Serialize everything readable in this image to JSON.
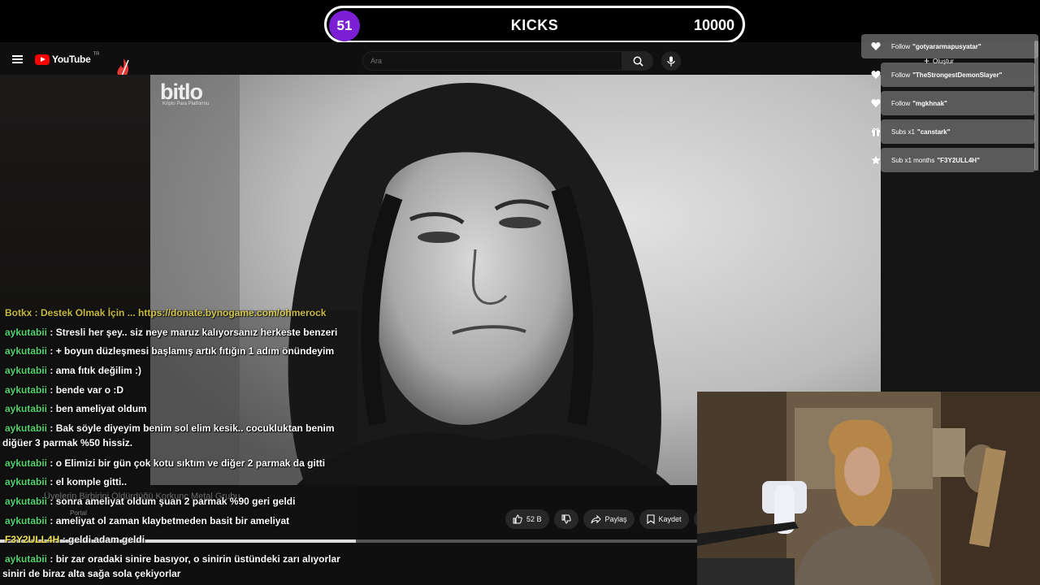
{
  "counter": {
    "current": "51",
    "label": "KICKS",
    "goal": "10000",
    "accent": "#7b1fd4"
  },
  "youtube": {
    "logo_text": "YouTube",
    "country_code": "TR",
    "search_placeholder": "Ara",
    "create_label": "Oluştur"
  },
  "video": {
    "watermark": "bitlo",
    "watermark_sub": "Kripto Para Platformu",
    "title": "Üyelerin Birbirini Öldürdüğü Korkunç Metal Grubu",
    "channel": "Portal",
    "like_count": "52 B",
    "share_label": "Paylaş",
    "save_label": "Kaydet",
    "progress": 0.51
  },
  "alerts": [
    {
      "icon": "heart-icon",
      "prefix": "Follow",
      "name": "\"gotyararmapusyatar\""
    },
    {
      "icon": "heart-icon",
      "prefix": "Follow",
      "name": "\"TheStrongestDemonSlayer\""
    },
    {
      "icon": "heart-icon",
      "prefix": "Follow",
      "name": "\"mgkhnak\""
    },
    {
      "icon": "gift-icon",
      "prefix": "Subs x1",
      "name": "\"canstark\""
    },
    {
      "icon": "star-icon",
      "prefix": "Sub x1 months",
      "name": "\"F3Y2ULL4H\""
    }
  ],
  "chat": {
    "partial_top": "Botkx : Destek Olmak İçin ... https://donate.bynogame.com/ohmerock",
    "lines": [
      {
        "user": "aykutabii",
        "text": " : Stresli her şey.. siz neye maruz kalıyorsanız herkeste benzeri"
      },
      {
        "user": "aykutabii",
        "text": " : + boyun düzleşmesi başlamış artık fıtığın 1 adım önündeyim"
      },
      {
        "user": "aykutabii",
        "text": " : ama fıtık değilim :)"
      },
      {
        "user": "aykutabii",
        "text": " : bende var o :D"
      },
      {
        "user": "aykutabii",
        "text": " : ben ameliyat oldum"
      },
      {
        "user": "aykutabii",
        "text": " : Bak söyle diyeyim benim sol elim kesik.. cocukluktan benim",
        "cont": "diğüer 3 parmak %50 hissiz."
      },
      {
        "user": "aykutabii",
        "text": " : o Elimizi bir gün çok kotu sıktım ve diğer 2 parmak da gitti"
      },
      {
        "user": "aykutabii",
        "text": " : el komple gitti.."
      },
      {
        "user": "aykutabii",
        "text": " : sonra ameliyat oldum şuan 2 parmak %90 geri geldi"
      },
      {
        "user": "aykutabii",
        "text": " : ameliyat ol zaman klaybetmeden basit bir ameliyat"
      },
      {
        "user": "F3Y2ULL4H",
        "text": " : geldi adam geldi",
        "alt": true
      },
      {
        "user": "aykutabii",
        "text": " : bir zar oradaki sinire basıyor, o sinirin üstündeki zarı alıyorlar",
        "cont": "siniri de biraz alta sağa sola çekiyorlar"
      }
    ]
  }
}
